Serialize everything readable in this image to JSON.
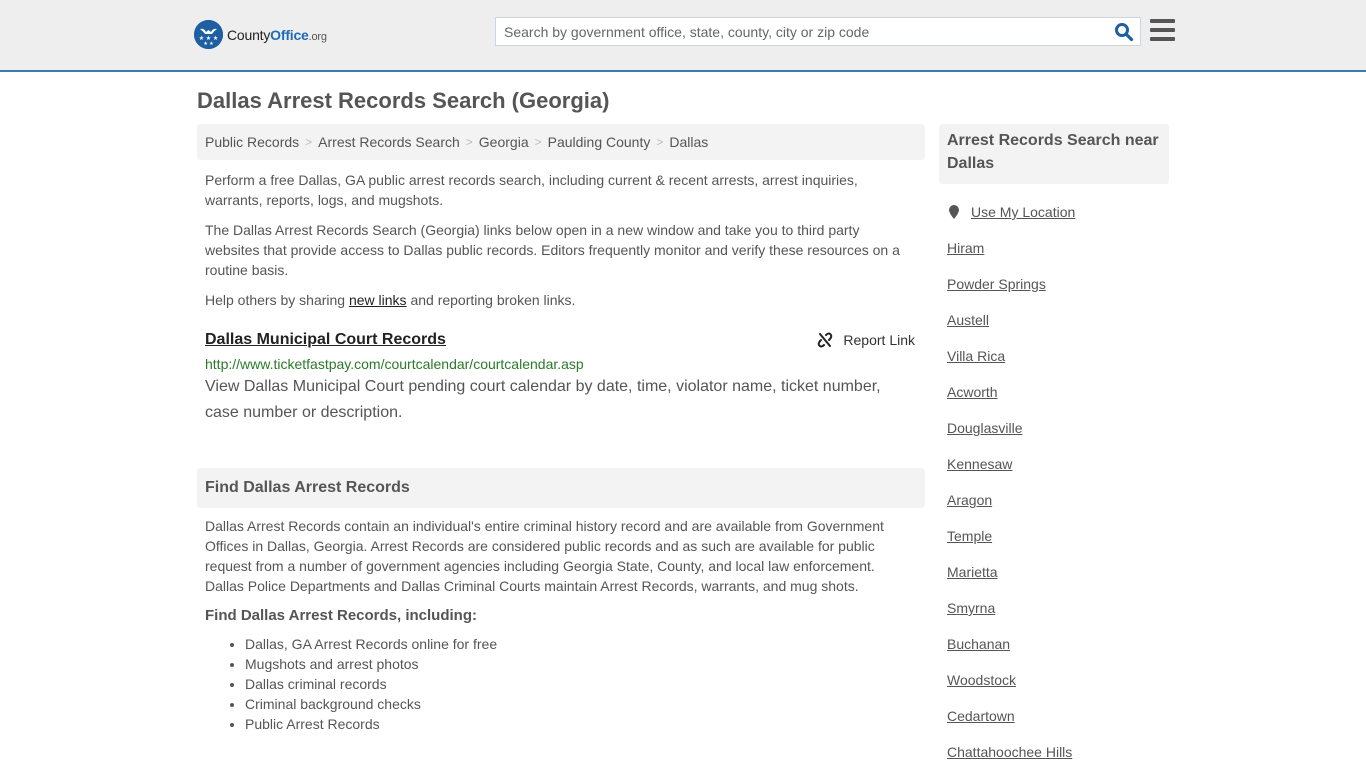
{
  "header": {
    "logo": {
      "name_part1": "County",
      "name_part2": "Office",
      "name_part3": ".org",
      "emblem": "★★★"
    },
    "search_placeholder": "Search by government office, state, county, city or zip code",
    "search_icon": "search-icon",
    "menu_icon": "hamburger-menu-icon"
  },
  "page": {
    "title": "Dallas Arrest Records Search (Georgia)"
  },
  "breadcrumb": [
    {
      "label": "Public Records"
    },
    {
      "label": "Arrest Records Search"
    },
    {
      "label": "Georgia"
    },
    {
      "label": "Paulding County"
    },
    {
      "label": "Dallas"
    }
  ],
  "breadcrumb_sep": ">",
  "intro": {
    "p1": "Perform a free Dallas, GA public arrest records search, including current & recent arrests, arrest inquiries, warrants, reports, logs, and mugshots.",
    "p2": "The Dallas Arrest Records Search (Georgia) links below open in a new window and take you to third party websites that provide access to Dallas public records. Editors frequently monitor and verify these resources on a routine basis.",
    "p3_before": "Help others by sharing ",
    "p3_link": "new links",
    "p3_after": " and reporting broken links."
  },
  "result": {
    "title": "Dallas Municipal Court Records",
    "report_label": "Report Link",
    "url": "http://www.ticketfastpay.com/courtcalendar/courtcalendar.asp",
    "description": "View Dallas Municipal Court pending court calendar by date, time, violator name, ticket number, case number or description."
  },
  "find_section": {
    "heading": "Find Dallas Arrest Records",
    "body": "Dallas Arrest Records contain an individual's entire criminal history record and are available from Government Offices in Dallas, Georgia. Arrest Records are considered public records and as such are available for public request from a number of government agencies including Georgia State, County, and local law enforcement. Dallas Police Departments and Dallas Criminal Courts maintain Arrest Records, warrants, and mug shots.",
    "subheading": "Find Dallas Arrest Records, including:",
    "items": [
      "Dallas, GA Arrest Records online for free",
      "Mugshots and arrest photos",
      "Dallas criminal records",
      "Criminal background checks",
      "Public Arrest Records"
    ]
  },
  "sidebar": {
    "heading": "Arrest Records Search near Dallas",
    "use_location": "Use My Location",
    "cities": [
      "Hiram",
      "Powder Springs",
      "Austell",
      "Villa Rica",
      "Acworth",
      "Douglasville",
      "Kennesaw",
      "Aragon",
      "Temple",
      "Marietta",
      "Smyrna",
      "Buchanan",
      "Woodstock",
      "Cedartown",
      "Chattahoochee Hills"
    ]
  }
}
